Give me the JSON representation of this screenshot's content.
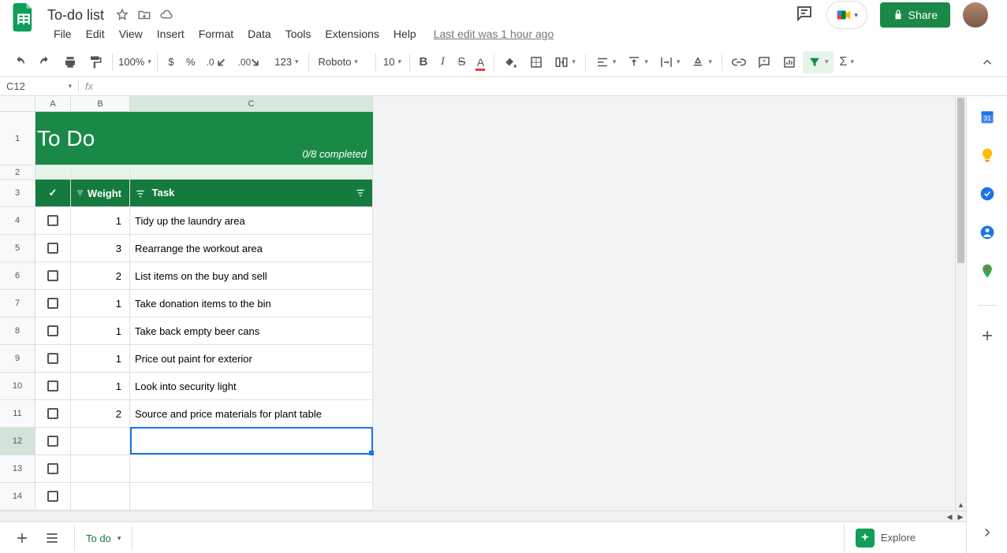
{
  "doc": {
    "title": "To-do list",
    "last_edit": "Last edit was 1 hour ago"
  },
  "menu": {
    "file": "File",
    "edit": "Edit",
    "view": "View",
    "insert": "Insert",
    "format": "Format",
    "data": "Data",
    "tools": "Tools",
    "extensions": "Extensions",
    "help": "Help"
  },
  "toolbar": {
    "zoom": "100%",
    "font": "Roboto",
    "font_size": "10",
    "more_formats": "123"
  },
  "name_box": "C12",
  "share_label": "Share",
  "sheet": {
    "title": "To Do",
    "completed": "0/8 completed",
    "headers": {
      "check": "✓",
      "weight": "Weight",
      "task": "Task"
    },
    "rows": [
      {
        "n": "4",
        "weight": "1",
        "task": "Tidy up the laundry area"
      },
      {
        "n": "5",
        "weight": "3",
        "task": "Rearrange the workout area"
      },
      {
        "n": "6",
        "weight": "2",
        "task": "List items on the buy and sell"
      },
      {
        "n": "7",
        "weight": "1",
        "task": "Take donation items to the bin"
      },
      {
        "n": "8",
        "weight": "1",
        "task": "Take back empty beer cans"
      },
      {
        "n": "9",
        "weight": "1",
        "task": "Price out paint for exterior"
      },
      {
        "n": "10",
        "weight": "1",
        "task": "Look into security light"
      },
      {
        "n": "11",
        "weight": "2",
        "task": "Source and price materials for plant table"
      },
      {
        "n": "12",
        "weight": "",
        "task": ""
      },
      {
        "n": "13",
        "weight": "",
        "task": ""
      },
      {
        "n": "14",
        "weight": "",
        "task": ""
      }
    ]
  },
  "tabs": {
    "active": "To do"
  },
  "explore_label": "Explore"
}
